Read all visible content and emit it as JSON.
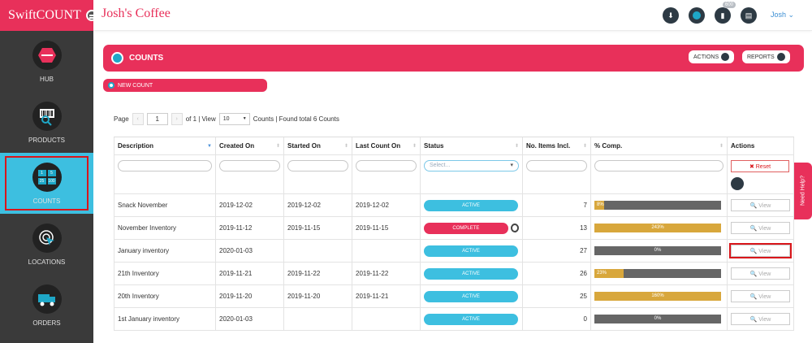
{
  "brand": "SwiftCOUNT",
  "shop_name": "Josh's Coffee",
  "top_icons": [
    {
      "name": "download-icon"
    },
    {
      "name": "settings-icon"
    },
    {
      "name": "notifications-icon",
      "badge": "600"
    },
    {
      "name": "clipboard-icon"
    }
  ],
  "user": "Josh ⌄",
  "sidebar": {
    "items": [
      {
        "label": "HUB",
        "icon": "hub-icon"
      },
      {
        "label": "PRODUCTS",
        "icon": "barcode-icon"
      },
      {
        "label": "COUNTS",
        "icon": "counts-icon",
        "tiles": [
          "1",
          "5",
          "25",
          "100"
        ]
      },
      {
        "label": "LOCATIONS",
        "icon": "location-icon"
      },
      {
        "label": "ORDERS",
        "icon": "truck-icon"
      }
    ]
  },
  "banner": {
    "title": "COUNTS",
    "actions_label": "ACTIONS",
    "reports_label": "REPORTS"
  },
  "new_count_label": "NEW COUNT",
  "pager": {
    "page_label": "Page",
    "prev": "‹",
    "page": "1",
    "next": "›",
    "of_view": "of 1 | View",
    "per_page": "10",
    "summary": "Counts | Found total 6 Counts"
  },
  "table": {
    "headers": [
      "Description",
      "Created On",
      "Started On",
      "Last Count On",
      "Status",
      "No. Items Incl.",
      "% Comp.",
      "Actions"
    ],
    "status_placeholder": "Select...",
    "reset_label": "✖ Reset",
    "view_label": "🔍 View",
    "rows": [
      {
        "description": "Snack November",
        "created": "2019-12-02",
        "started": "2019-12-02",
        "last": "2019-12-02",
        "status": "ACTIVE",
        "items": "7",
        "comp_label": "8%",
        "comp": 0.08
      },
      {
        "description": "November Inventory",
        "created": "2019-11-12",
        "started": "2019-11-15",
        "last": "2019-11-15",
        "status": "COMPLETE",
        "items": "13",
        "comp_label": "243%",
        "comp": 1.0
      },
      {
        "description": "January inventory",
        "created": "2020-01-03",
        "started": "",
        "last": "",
        "status": "ACTIVE",
        "items": "27",
        "comp_label": "0%",
        "comp": 0
      },
      {
        "description": "21th Inventory",
        "created": "2019-11-21",
        "started": "2019-11-22",
        "last": "2019-11-22",
        "status": "ACTIVE",
        "items": "26",
        "comp_label": "23%",
        "comp": 0.23
      },
      {
        "description": "20th Inventory",
        "created": "2019-11-20",
        "started": "2019-11-20",
        "last": "2019-11-21",
        "status": "ACTIVE",
        "items": "25",
        "comp_label": "160%",
        "comp": 1.0
      },
      {
        "description": "1st January inventory",
        "created": "2020-01-03",
        "started": "",
        "last": "",
        "status": "ACTIVE",
        "items": "0",
        "comp_label": "0%",
        "comp": 0
      }
    ]
  },
  "help_label": "Need Help?",
  "colors": {
    "brand": "#e8305a",
    "accent": "#3dbfe0",
    "progress": "#d8a73c",
    "highlight": "#d9161b"
  }
}
